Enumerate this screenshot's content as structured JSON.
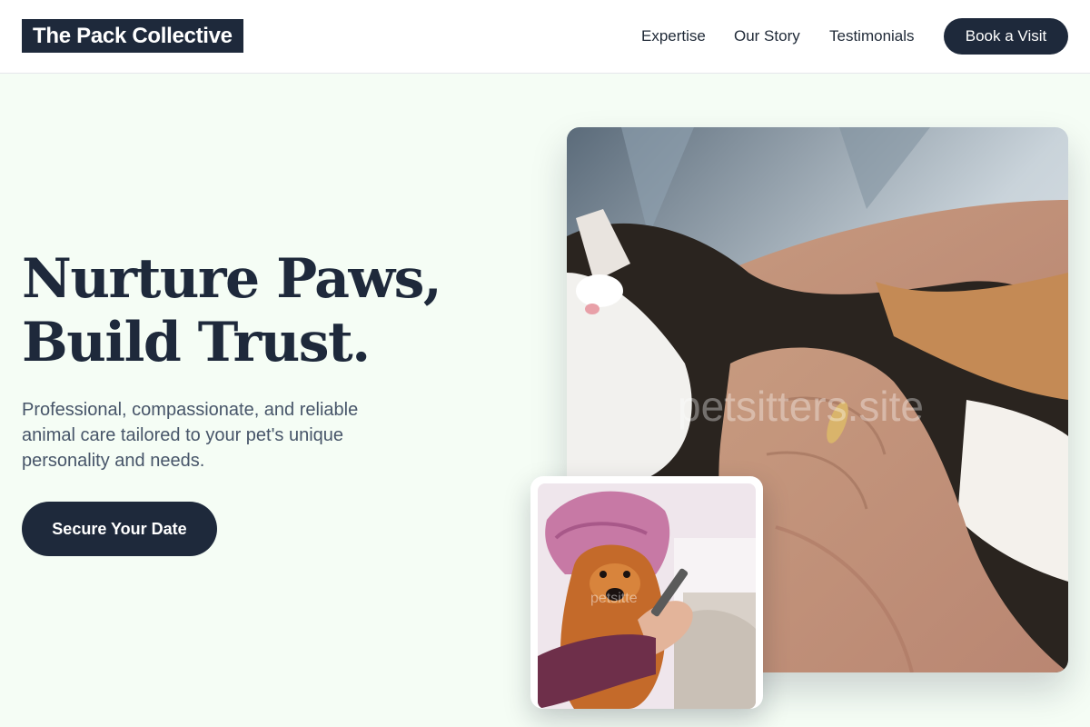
{
  "header": {
    "logo": "The Pack Collective",
    "nav": [
      "Expertise",
      "Our Story",
      "Testimonials"
    ],
    "cta_label": "Book a Visit"
  },
  "hero": {
    "title_line1": "Nurture Paws,",
    "title_line2": "Build Trust.",
    "subtitle": "Professional, compassionate, and reliable animal care tailored to your pet's unique personality and needs.",
    "cta_label": "Secure Your Date"
  },
  "images": {
    "main_watermark": "petsitters.site",
    "small_watermark": "petsitte"
  },
  "colors": {
    "brand": "#1e293b",
    "background": "#f5fdf5",
    "text_muted": "#475569"
  }
}
